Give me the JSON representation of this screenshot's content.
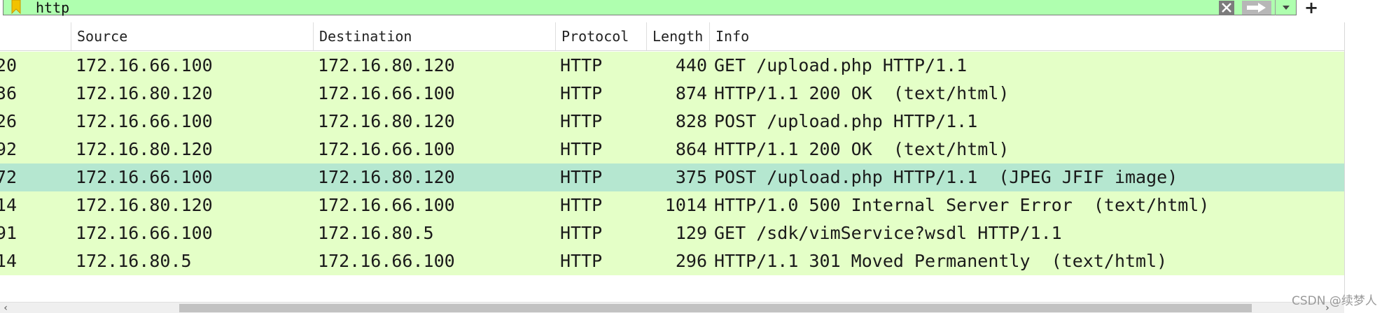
{
  "filter": {
    "value": "http",
    "bookmark_icon": "bookmark-icon",
    "clear_icon": "clear-x-icon",
    "apply_icon": "arrow-right-icon",
    "dropdown_icon": "chevron-down-icon",
    "add_label": "+"
  },
  "columns": {
    "source": "Source",
    "destination": "Destination",
    "protocol": "Protocol",
    "length": "Length",
    "info": "Info"
  },
  "packets": [
    {
      "no": "20",
      "source": "172.16.66.100",
      "destination": "172.16.80.120",
      "protocol": "HTTP",
      "length": "440",
      "info": "GET /upload.php HTTP/1.1",
      "selected": false
    },
    {
      "no": "36",
      "source": "172.16.80.120",
      "destination": "172.16.66.100",
      "protocol": "HTTP",
      "length": "874",
      "info": "HTTP/1.1 200 OK  (text/html)",
      "selected": false
    },
    {
      "no": "26",
      "source": "172.16.66.100",
      "destination": "172.16.80.120",
      "protocol": "HTTP",
      "length": "828",
      "info": "POST /upload.php HTTP/1.1",
      "selected": false
    },
    {
      "no": "92",
      "source": "172.16.80.120",
      "destination": "172.16.66.100",
      "protocol": "HTTP",
      "length": "864",
      "info": "HTTP/1.1 200 OK  (text/html)",
      "selected": false
    },
    {
      "no": "72",
      "source": "172.16.66.100",
      "destination": "172.16.80.120",
      "protocol": "HTTP",
      "length": "375",
      "info": "POST /upload.php HTTP/1.1  (JPEG JFIF image)",
      "selected": true
    },
    {
      "no": "14",
      "source": "172.16.80.120",
      "destination": "172.16.66.100",
      "protocol": "HTTP",
      "length": "1014",
      "info": "HTTP/1.0 500 Internal Server Error  (text/html)",
      "selected": false
    },
    {
      "no": "91",
      "source": "172.16.66.100",
      "destination": "172.16.80.5",
      "protocol": "HTTP",
      "length": "129",
      "info": "GET /sdk/vimService?wsdl HTTP/1.1",
      "selected": false
    },
    {
      "no": "14",
      "source": "172.16.80.5",
      "destination": "172.16.66.100",
      "protocol": "HTTP",
      "length": "296",
      "info": "HTTP/1.1 301 Moved Permanently  (text/html)",
      "selected": false
    }
  ],
  "scrollbar": {
    "left_arrow": "‹",
    "right_arrow": "›"
  },
  "watermark": "CSDN @续梦人",
  "colors": {
    "filter_valid_bg": "#afffaf",
    "http_row_bg": "#e4ffc7",
    "selected_row_bg": "#b5e7d0"
  }
}
